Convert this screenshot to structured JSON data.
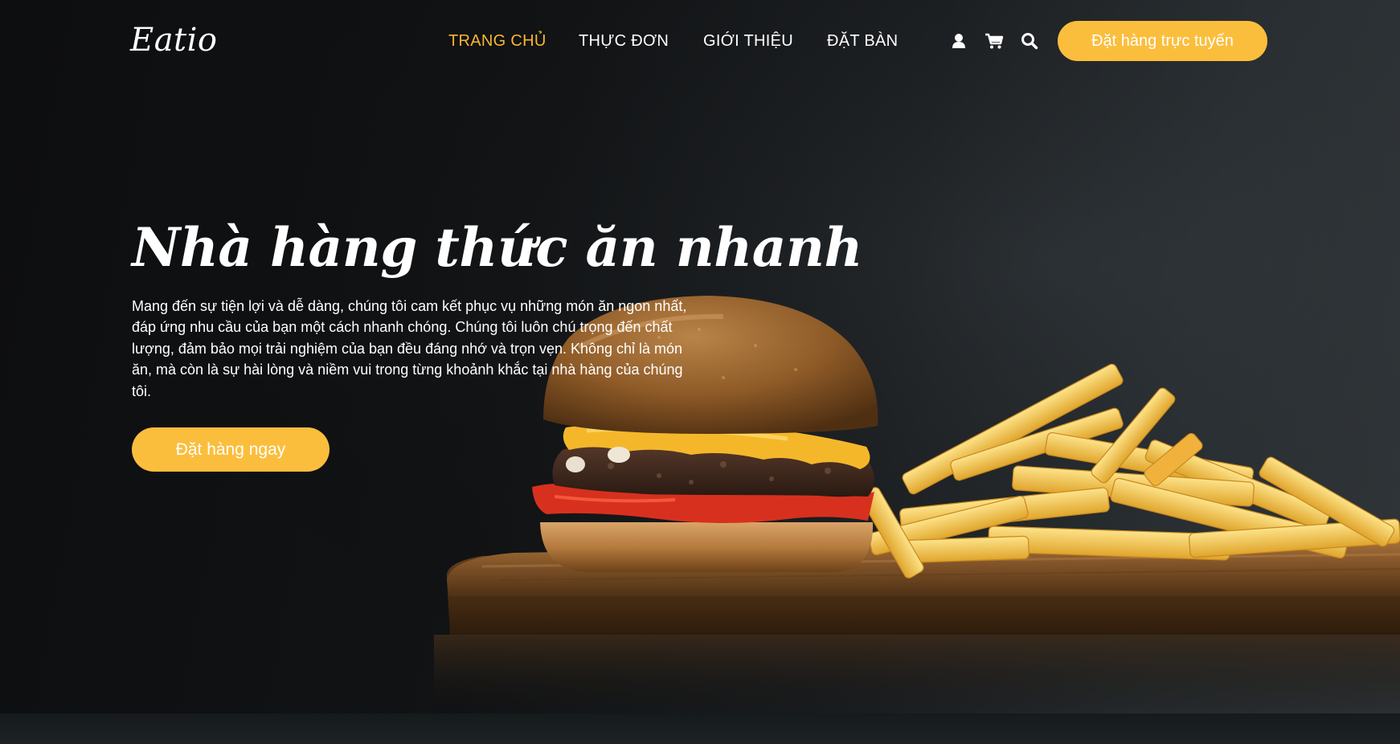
{
  "brand": {
    "logo_text": "Eatio"
  },
  "nav": {
    "items": [
      {
        "label": "TRANG CHỦ",
        "active": true
      },
      {
        "label": "THỰC ĐƠN",
        "active": false
      },
      {
        "label": "GIỚI THIỆU",
        "active": false
      },
      {
        "label": "ĐẶT BÀN",
        "active": false
      }
    ],
    "icons": [
      "user-icon",
      "cart-icon",
      "search-icon"
    ],
    "cta_label": "Đặt hàng trực tuyến"
  },
  "hero": {
    "title": "Nhà hàng thức ăn nhanh",
    "description": "Mang đến sự tiện lợi và dễ dàng, chúng tôi cam kết phục vụ những món ăn ngon nhất, đáp ứng nhu cầu của bạn một cách nhanh chóng. Chúng tôi luôn chú trọng đến chất lượng, đảm bảo mọi trải nghiệm của bạn đều đáng nhớ và trọn vẹn. Không chỉ là món ăn, mà còn là sự hài lòng và niềm vui trong từng khoảnh khắc tại nhà hàng của chúng tôi.",
    "cta_label": "Đặt hàng ngay",
    "image": "burger-and-fries-on-wooden-board"
  },
  "colors": {
    "accent": "#fbbe3c",
    "active_nav": "#f9b533",
    "background": "#111315",
    "text": "#ffffff"
  }
}
